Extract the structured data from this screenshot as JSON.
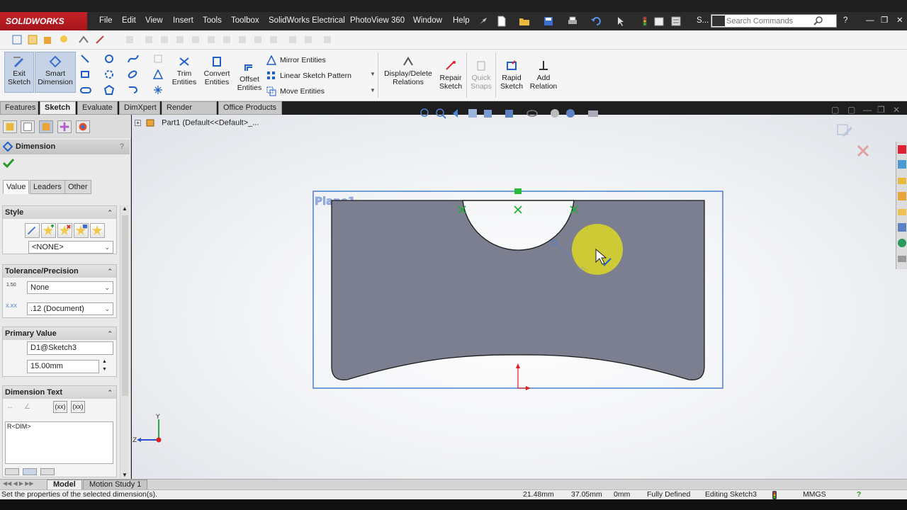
{
  "app": {
    "logo": "SOLIDWORKS",
    "menu": [
      "File",
      "Edit",
      "View",
      "Insert",
      "Tools",
      "Toolbox",
      "SolidWorks Electrical",
      "PhotoView 360",
      "Window",
      "Help"
    ],
    "search_placeholder": "Search Commands",
    "s_label": "S...",
    "help_label": "?"
  },
  "command_manager": {
    "exit_sketch": "Exit Sketch",
    "smart_dimension": "Smart Dimension",
    "trim_entities": "Trim Entities",
    "convert_entities": "Convert Entities",
    "offset_entities": "Offset Entities",
    "mirror_entities": "Mirror Entities",
    "linear_sketch_pattern": "Linear Sketch Pattern",
    "move_entities": "Move Entities",
    "display_delete_relations": "Display/Delete Relations",
    "repair_sketch": "Repair Sketch",
    "quick_snaps": "Quick Snaps",
    "rapid_sketch": "Rapid Sketch",
    "add_relation": "Add Relation"
  },
  "tabs": [
    "Features",
    "Sketch",
    "Evaluate",
    "DimXpert",
    "Render Tools",
    "Office Products"
  ],
  "active_tab": "Sketch",
  "property_manager": {
    "title": "Dimension",
    "help": "?",
    "subtabs": [
      "Value",
      "Leaders",
      "Other"
    ],
    "style": {
      "header": "Style",
      "combo": "<NONE>"
    },
    "tolerance": {
      "header": "Tolerance/Precision",
      "tol_icon_text": "1.50",
      "tolerance_type": "None",
      "precision_icon_text": "X.XX",
      "precision": ".12 (Document)"
    },
    "primary_value": {
      "header": "Primary Value",
      "name": "D1@Sketch3",
      "value": "15.00mm"
    },
    "dimension_text": {
      "header": "Dimension Text",
      "text": "R<DIM>",
      "btn1": "(xx)",
      "btn2": "(xx)"
    }
  },
  "graphics": {
    "tree_item": "Part1  (Default<<Default>_...",
    "plane_label": "Plane1",
    "triad_y": "Y",
    "triad_z": "Z"
  },
  "bottom_tabs": [
    "Model",
    "Motion Study 1"
  ],
  "status": {
    "message": "Set the properties of the selected dimension(s).",
    "x": "21.48mm",
    "y": "37.05mm",
    "z": "0mm",
    "state": "Fully Defined",
    "editing": "Editing Sketch3",
    "units": "MMGS"
  },
  "colors": {
    "accent": "#c62027",
    "sketch_face": "#7c7f8f",
    "plane_border": "#4a7fd4",
    "highlight": "#e6df1e"
  }
}
